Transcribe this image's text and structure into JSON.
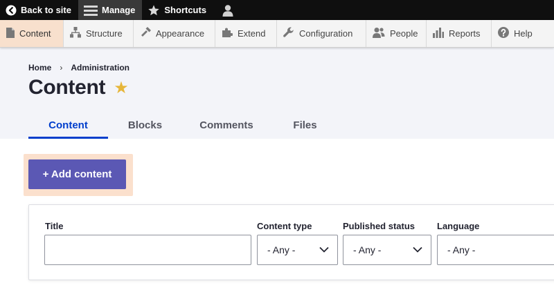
{
  "toolbar": {
    "back_label": "Back to site",
    "manage_label": "Manage",
    "shortcuts_label": "Shortcuts",
    "user_icon": "user-icon"
  },
  "tray": {
    "items": [
      {
        "label": "Content",
        "icon": "content-icon",
        "active": true
      },
      {
        "label": "Structure",
        "icon": "structure-icon"
      },
      {
        "label": "Appearance",
        "icon": "appearance-icon"
      },
      {
        "label": "Extend",
        "icon": "extend-icon"
      },
      {
        "label": "Configuration",
        "icon": "configuration-icon"
      },
      {
        "label": "People",
        "icon": "people-icon"
      },
      {
        "label": "Reports",
        "icon": "reports-icon"
      },
      {
        "label": "Help",
        "icon": "help-icon"
      }
    ]
  },
  "breadcrumb": {
    "home": "Home",
    "separator": "›",
    "admin": "Administration"
  },
  "page": {
    "title": "Content",
    "star": "★"
  },
  "tabs": [
    {
      "label": "Content",
      "active": true
    },
    {
      "label": "Blocks"
    },
    {
      "label": "Comments"
    },
    {
      "label": "Files"
    }
  ],
  "add_button": {
    "label": "+ Add content"
  },
  "filters": {
    "title_label": "Title",
    "title_value": "",
    "content_type_label": "Content type",
    "content_type_value": "- Any -",
    "published_status_label": "Published status",
    "published_status_value": "- Any -",
    "language_label": "Language",
    "language_value": "- Any -"
  },
  "colors": {
    "toolbar_bg": "#0f0f0f",
    "active_tray_bg": "#f8e0cd",
    "tab_active": "#003ecc",
    "primary_button": "#5b58b4",
    "highlight": "#fbe0cd",
    "star": "#e6b63a"
  }
}
